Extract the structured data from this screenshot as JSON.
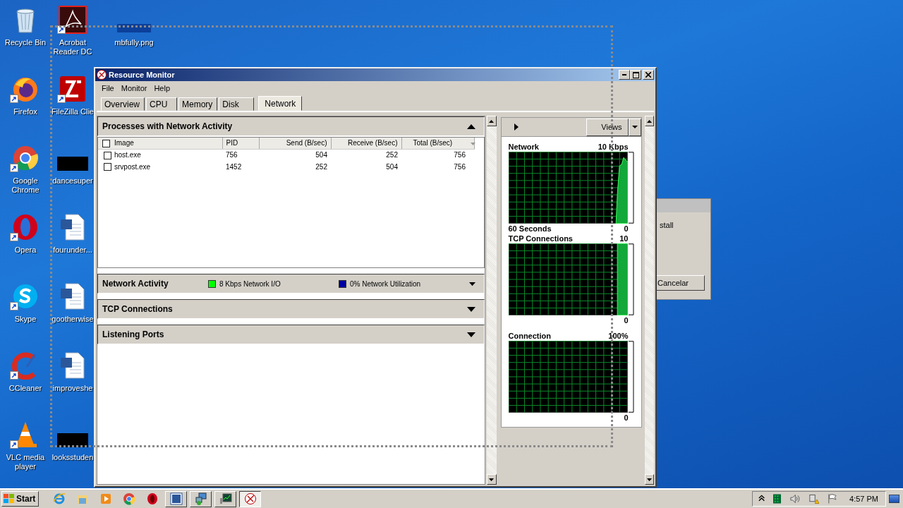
{
  "desktop": {
    "icons": [
      {
        "label": "Recycle Bin",
        "kind": "recycle",
        "shortcut": false
      },
      {
        "label": "Firefox",
        "kind": "firefox",
        "shortcut": true
      },
      {
        "label": "Google Chrome",
        "kind": "chrome",
        "shortcut": true
      },
      {
        "label": "Opera",
        "kind": "opera",
        "shortcut": true
      },
      {
        "label": "Skype",
        "kind": "skype",
        "shortcut": true
      },
      {
        "label": "CCleaner",
        "kind": "ccleaner",
        "shortcut": true
      },
      {
        "label": "VLC media player",
        "kind": "vlc",
        "shortcut": true
      },
      {
        "label": "Acrobat Reader DC",
        "kind": "acrobat",
        "shortcut": true
      },
      {
        "label": "FileZilla Clie",
        "kind": "filezilla",
        "shortcut": true
      },
      {
        "label": "dancesuper",
        "kind": "redacted",
        "shortcut": false
      },
      {
        "label": "fourunder...",
        "kind": "word",
        "shortcut": false
      },
      {
        "label": "gootherwise",
        "kind": "word",
        "shortcut": false
      },
      {
        "label": "improveshe",
        "kind": "word",
        "shortcut": false
      },
      {
        "label": "looksstuden",
        "kind": "redacted",
        "shortcut": false
      },
      {
        "label": "mbfully.png",
        "kind": "image",
        "shortcut": false
      }
    ]
  },
  "background_dialog": {
    "text": "stall",
    "button": "Cancelar"
  },
  "window": {
    "title": "Resource Monitor",
    "menu": [
      "File",
      "Monitor",
      "Help"
    ],
    "tabs": [
      {
        "label": "Overview",
        "selected": false
      },
      {
        "label": "CPU",
        "selected": false
      },
      {
        "label": "Memory",
        "selected": false
      },
      {
        "label": "Disk",
        "selected": false
      },
      {
        "label": "Network",
        "selected": true
      }
    ],
    "processes": {
      "title": "Processes with Network Activity",
      "expanded": true,
      "header_checked": false,
      "columns": [
        "Image",
        "PID",
        "Send (B/sec)",
        "Receive (B/sec)",
        "Total (B/sec)"
      ],
      "rows": [
        {
          "checked": false,
          "cells": [
            "host.exe",
            "756",
            "504",
            "252",
            "756"
          ]
        },
        {
          "checked": false,
          "cells": [
            "srvpost.exe",
            "1452",
            "252",
            "504",
            "756"
          ]
        }
      ]
    },
    "sections": [
      {
        "title": "Network Activity",
        "expanded": false,
        "legend": [
          {
            "text": "8 Kbps Network I/O",
            "color": "#00ff00"
          },
          {
            "text": "0% Network Utilization",
            "color": "#0000a0"
          }
        ]
      },
      {
        "title": "TCP Connections",
        "expanded": false
      },
      {
        "title": "Listening Ports",
        "expanded": false
      }
    ],
    "views_button": "Views",
    "graphs": [
      {
        "title": "Network",
        "max": "10 Kbps",
        "caption": "60 Seconds",
        "min": "0",
        "kind": "spike"
      },
      {
        "title": "TCP Connections",
        "max": "10",
        "min": "0",
        "kind": "plateau"
      },
      {
        "title": "Connection",
        "max": "100%",
        "min": "0",
        "kind": "flat"
      }
    ]
  },
  "taskbar": {
    "start": "Start",
    "items": [
      {
        "kind": "ie",
        "running": false,
        "selected": false
      },
      {
        "kind": "folder",
        "running": false,
        "selected": false
      },
      {
        "kind": "media",
        "running": false,
        "selected": false
      },
      {
        "kind": "chrome",
        "running": false,
        "selected": false
      },
      {
        "kind": "opera",
        "running": false,
        "selected": false
      },
      {
        "kind": "word",
        "running": true,
        "selected": false
      },
      {
        "kind": "network",
        "running": true,
        "selected": false
      },
      {
        "kind": "monitor",
        "running": true,
        "selected": false
      },
      {
        "kind": "resmon",
        "running": true,
        "selected": true
      }
    ],
    "clock": "4:57 PM"
  }
}
